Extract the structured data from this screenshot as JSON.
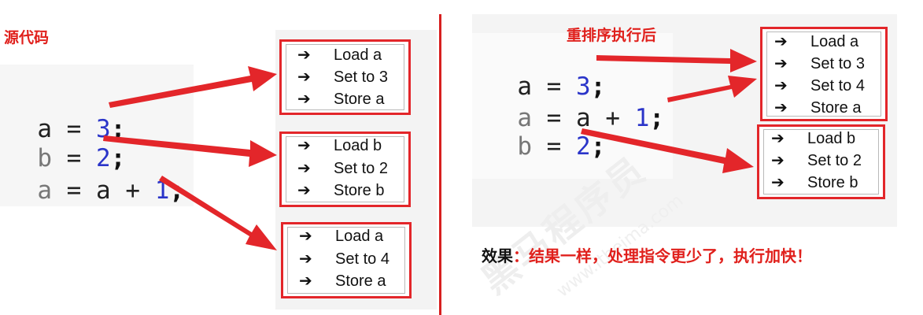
{
  "left": {
    "title": "源代码",
    "code_lines": [
      {
        "var": "a",
        "op": "=",
        "expr": "3",
        "semi": ";"
      },
      {
        "var": "b",
        "op": "=",
        "expr": "2",
        "semi": ";"
      },
      {
        "var": "a",
        "op": "=",
        "rhs_var": "a",
        "plus": "+",
        "expr": "1",
        "semi": ";"
      }
    ],
    "boxes": [
      [
        "Load a",
        "Set to 3",
        "Store a"
      ],
      [
        "Load b",
        "Set to 2",
        "Store b"
      ],
      [
        "Load a",
        "Set to 4",
        "Store a"
      ]
    ]
  },
  "right": {
    "title": "重排序执行后",
    "code_lines": [
      {
        "var": "a",
        "op": "=",
        "expr": "3",
        "semi": ";"
      },
      {
        "var": "a",
        "op": "=",
        "rhs_var": "a",
        "plus": "+",
        "expr": "1",
        "semi": ";"
      },
      {
        "var": "b",
        "op": "=",
        "expr": "2",
        "semi": ";"
      }
    ],
    "boxes": [
      [
        "Load a",
        "Set to 3",
        "Set to 4",
        "Store a"
      ],
      [
        "Load b",
        "Set to 2",
        "Store b"
      ]
    ]
  },
  "arrow_glyph": "➔",
  "effect": {
    "label": "效果",
    "text": "：结果一样，处理指令更少了，执行加快！"
  },
  "watermark": {
    "brand": "黑马程序员",
    "site": "www.itheima.com"
  },
  "colors": {
    "accent_red": "#e3262a",
    "number_blue": "#2b35c9"
  }
}
